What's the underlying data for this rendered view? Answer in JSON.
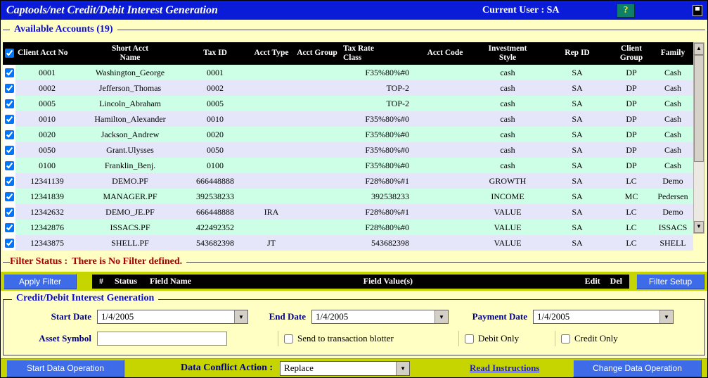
{
  "colors": {
    "titlebar_blue": "#0b1cd8",
    "page_yellow": "#FFFFC4",
    "strip_chartreuse": "#C6D500",
    "row_green": "#CCFFE6",
    "row_lavender": "#E6E6FA",
    "button_blue": "#3E6BE8",
    "status_red": "#A00000",
    "link_blue": "#2222CC"
  },
  "icons": {
    "dropdown": "▼",
    "scroll_up": "▲",
    "scroll_down": "▼",
    "help": "?"
  },
  "titlebar": {
    "title": "Captools/net Credit/Debit Interest Generation",
    "current_user": "Current User : SA"
  },
  "accounts": {
    "group_title": "Available Accounts (19)",
    "headers": [
      "Client Acct No",
      "Short Acct Name",
      "Tax ID",
      "Acct Type",
      "Acct Group",
      "Tax Rate Class",
      "Acct Code",
      "Investment Style",
      "Rep ID",
      "Client Group",
      "Family"
    ],
    "rows": [
      [
        "0001",
        "Washington_George",
        "0001",
        "",
        "",
        "F35%80%#0",
        "",
        "cash",
        "SA",
        "DP",
        "Cash"
      ],
      [
        "0002",
        "Jefferson_Thomas",
        "0002",
        "",
        "",
        "TOP-2",
        "",
        "cash",
        "SA",
        "DP",
        "Cash"
      ],
      [
        "0005",
        "Lincoln_Abraham",
        "0005",
        "",
        "",
        "TOP-2",
        "",
        "cash",
        "SA",
        "DP",
        "Cash"
      ],
      [
        "0010",
        "Hamilton_Alexander",
        "0010",
        "",
        "",
        "F35%80%#0",
        "",
        "cash",
        "SA",
        "DP",
        "Cash"
      ],
      [
        "0020",
        "Jackson_Andrew",
        "0020",
        "",
        "",
        "F35%80%#0",
        "",
        "cash",
        "SA",
        "DP",
        "Cash"
      ],
      [
        "0050",
        "Grant.Ulysses",
        "0050",
        "",
        "",
        "F35%80%#0",
        "",
        "cash",
        "SA",
        "DP",
        "Cash"
      ],
      [
        "0100",
        "Franklin_Benj.",
        "0100",
        "",
        "",
        "F35%80%#0",
        "",
        "cash",
        "SA",
        "DP",
        "Cash"
      ],
      [
        "12341139",
        "DEMO.PF",
        "666448888",
        "",
        "",
        "F28%80%#1",
        "",
        "GROWTH",
        "SA",
        "LC",
        "Demo"
      ],
      [
        "12341839",
        "MANAGER.PF",
        "392538233",
        "",
        "",
        "392538233",
        "",
        "INCOME",
        "SA",
        "MC",
        "Pedersen"
      ],
      [
        "12342632",
        "DEMO_JE.PF",
        "666448888",
        "IRA",
        "",
        "F28%80%#1",
        "",
        "VALUE",
        "SA",
        "LC",
        "Demo"
      ],
      [
        "12342876",
        "ISSACS.PF",
        "422492352",
        "",
        "",
        "F28%80%#0",
        "",
        "VALUE",
        "SA",
        "LC",
        "ISSACS"
      ],
      [
        "12343875",
        "SHELL.PF",
        "543682398",
        "JT",
        "",
        "543682398",
        "",
        "VALUE",
        "SA",
        "LC",
        "SHELL"
      ]
    ]
  },
  "filter": {
    "status_label": "Filter Status :",
    "status_message": "There is No Filter defined.",
    "apply_button": "Apply Filter",
    "setup_button": "Filter Setup",
    "bar": {
      "num": "#",
      "status": "Status",
      "field_name": "Field Name",
      "field_values": "Field Value(s)",
      "edit": "Edit",
      "del": "Del"
    }
  },
  "generation": {
    "group_title": "Credit/Debit Interest Generation",
    "start_date_label": "Start Date",
    "start_date_value": "1/4/2005",
    "end_date_label": "End Date",
    "end_date_value": "1/4/2005",
    "payment_date_label": "Payment Date",
    "payment_date_value": "1/4/2005",
    "asset_symbol_label": "Asset Symbol",
    "asset_symbol_value": "",
    "blotter_checkbox_label": "Send to transaction blotter",
    "debit_checkbox_label": "Debit Only",
    "credit_checkbox_label": "Credit Only"
  },
  "footer": {
    "start_button": "Start Data Operation",
    "conflict_label": "Data Conflict Action :",
    "conflict_value": "Replace",
    "instructions_link": "Read Instructions",
    "change_button": "Change Data Operation"
  }
}
